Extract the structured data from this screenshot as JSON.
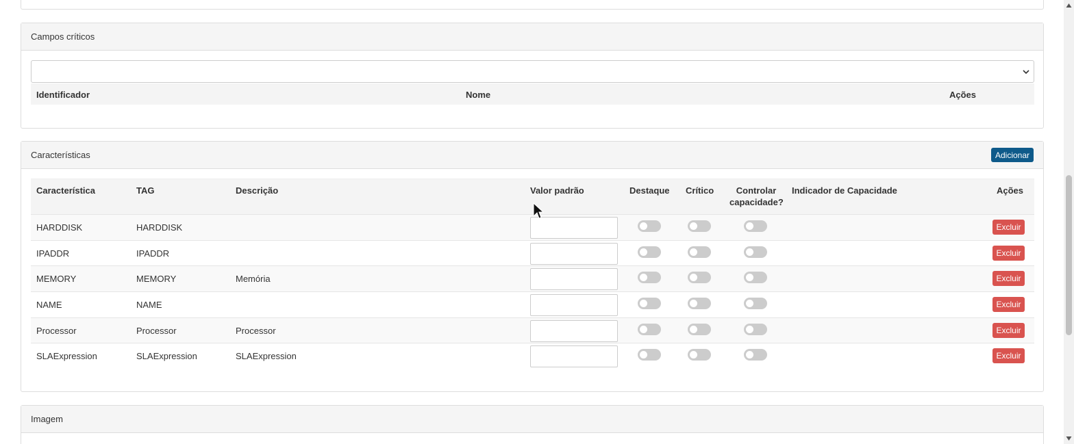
{
  "campos_criticos": {
    "title": "Campos críticos",
    "select_value": "",
    "columns": [
      "Identificador",
      "Nome",
      "Ações"
    ]
  },
  "caracteristicas": {
    "title": "Características",
    "add_label": "Adicionar",
    "columns": {
      "caracteristica": "Característica",
      "tag": "TAG",
      "descricao": "Descrição",
      "valor_padrao": "Valor padrão",
      "destaque": "Destaque",
      "critico": "Crítico",
      "controlar_1": "Controlar",
      "controlar_2": "capacidade?",
      "indicador": "Indicador de Capacidade",
      "acoes": "Ações"
    },
    "delete_label": "Excluir",
    "rows": [
      {
        "caracteristica": "HARDDISK",
        "tag": "HARDDISK",
        "descricao": "",
        "valor": "",
        "destaque": false,
        "critico": false,
        "controlar": false
      },
      {
        "caracteristica": "IPADDR",
        "tag": "IPADDR",
        "descricao": "",
        "valor": "",
        "destaque": false,
        "critico": false,
        "controlar": false
      },
      {
        "caracteristica": "MEMORY",
        "tag": "MEMORY",
        "descricao": "Memória",
        "valor": "",
        "destaque": false,
        "critico": false,
        "controlar": false
      },
      {
        "caracteristica": "NAME",
        "tag": "NAME",
        "descricao": "",
        "valor": "",
        "destaque": false,
        "critico": false,
        "controlar": false
      },
      {
        "caracteristica": "Processor",
        "tag": "Processor",
        "descricao": "Processor",
        "valor": "",
        "destaque": false,
        "critico": false,
        "controlar": false
      },
      {
        "caracteristica": "SLAExpression",
        "tag": "SLAExpression",
        "descricao": "SLAExpression",
        "valor": "",
        "destaque": false,
        "critico": false,
        "controlar": false
      }
    ]
  },
  "imagem": {
    "title": "Imagem"
  },
  "colors": {
    "primary": "#0e5a8a",
    "danger": "#d9534f",
    "toggle_off": "#cccccc",
    "panel_heading": "#f5f5f5"
  }
}
